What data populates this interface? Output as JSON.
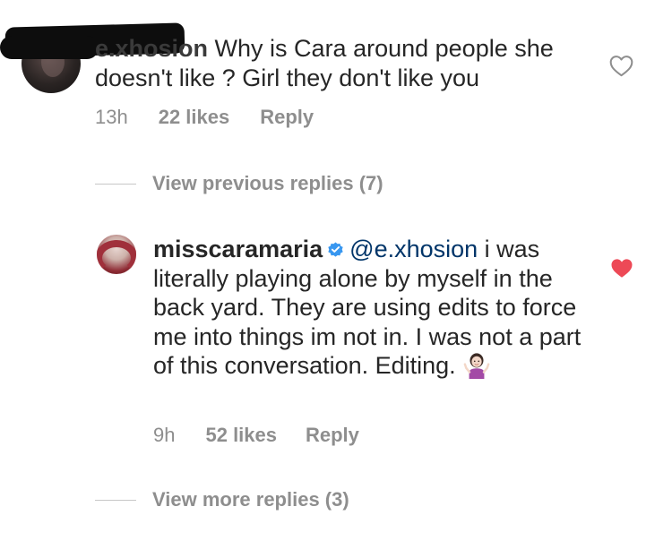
{
  "top_comment": {
    "username": "e.xhosion",
    "text": "Why is Cara around people she doesn't like ? Girl they don't like you",
    "time": "13h",
    "likes": "22 likes",
    "reply_label": "Reply",
    "liked": false
  },
  "view_previous": {
    "label": "View previous replies (7)"
  },
  "reply_comment": {
    "username": "misscaramaria",
    "verified": true,
    "mention": "@e.xhosion",
    "text": "i was literally playing alone by myself in the back yard. They are using edits to force me into things im not in. I was not a part of this conversation. Editing.",
    "emoji": "person-shrugging",
    "time": "9h",
    "likes": "52 likes",
    "reply_label": "Reply",
    "liked": true
  },
  "view_more": {
    "label": "View more replies (3)"
  },
  "colors": {
    "text": "#262626",
    "meta": "#8e8e8e",
    "mention": "#003569",
    "heart_filled": "#ed4956",
    "verified": "#3897f0"
  }
}
